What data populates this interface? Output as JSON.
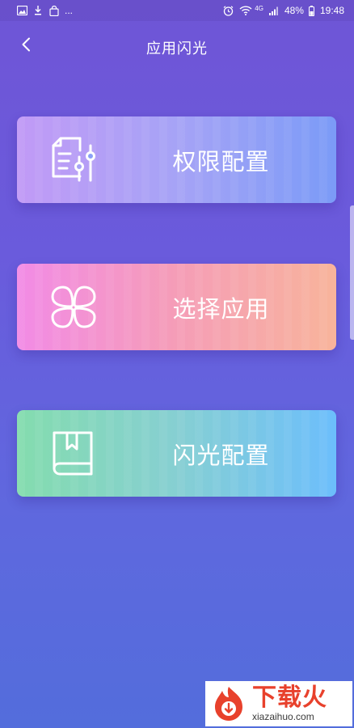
{
  "status_bar": {
    "left_icons": [
      "image-icon",
      "download-icon",
      "bag-icon"
    ],
    "more": "...",
    "right_icons": [
      "alarm-icon",
      "wifi-icon",
      "signal-icon",
      "battery-icon"
    ],
    "network": "4G",
    "battery": "48%",
    "time": "19:48"
  },
  "header": {
    "back_icon": "chevron-left-icon",
    "title": "应用闪光"
  },
  "cards": [
    {
      "label": "权限配置",
      "icon": "document-settings-icon",
      "colors": [
        "#c19af6",
        "#7b9bf7"
      ]
    },
    {
      "label": "选择应用",
      "icon": "clover-icon",
      "colors": [
        "#f28be6",
        "#f8b49b"
      ]
    },
    {
      "label": "闪光配置",
      "icon": "bookmark-book-icon",
      "colors": [
        "#84dcae",
        "#6cbefc"
      ]
    }
  ],
  "watermark": {
    "text": "下载火",
    "url": "xiazaihuo.com",
    "color": "#e8412c"
  }
}
